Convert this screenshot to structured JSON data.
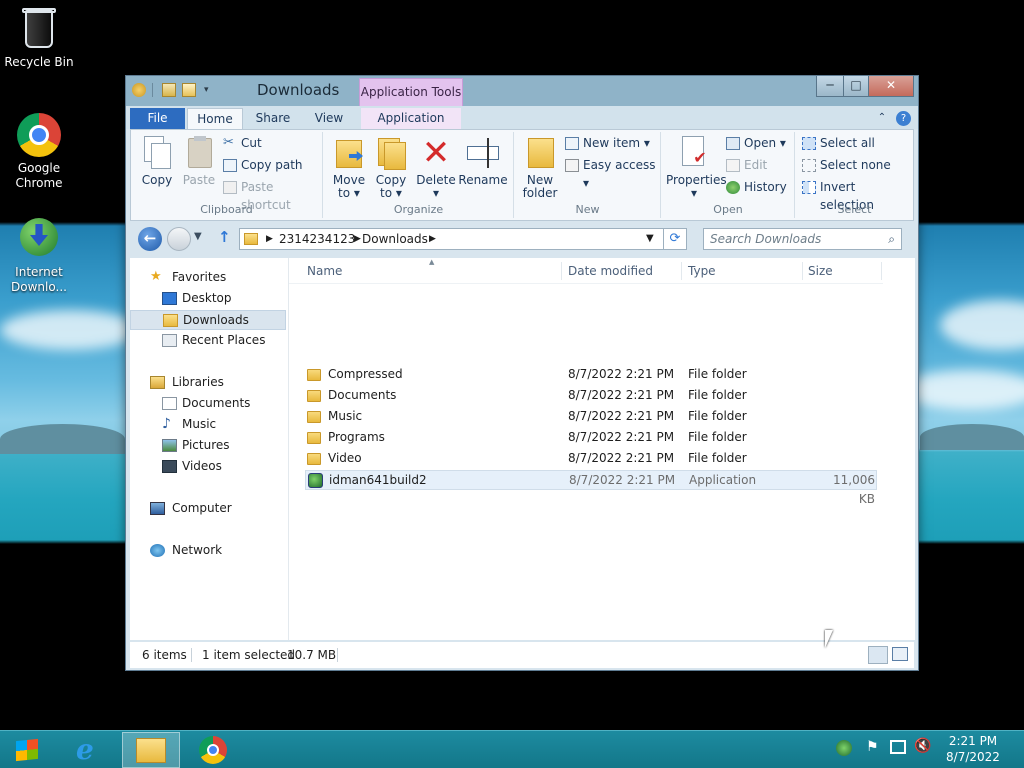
{
  "desktop": {
    "icons": [
      {
        "label_line1": "Recycle Bin",
        "label_line2": ""
      },
      {
        "label_line1": "Google",
        "label_line2": "Chrome"
      },
      {
        "label_line1": "Internet",
        "label_line2": "Downlo..."
      }
    ]
  },
  "window": {
    "title": "Downloads",
    "context_tab": "Application Tools",
    "buttons": {
      "minimize": "─",
      "maximize": "□",
      "close": "✕"
    },
    "tabs": [
      "File",
      "Home",
      "Share",
      "View",
      "Application"
    ],
    "ribbon": {
      "clipboard": {
        "label": "Clipboard",
        "copy": "Copy",
        "paste": "Paste",
        "cut": "Cut",
        "copy_path": "Copy path",
        "paste_shortcut": "Paste shortcut"
      },
      "organize": {
        "label": "Organize",
        "move_to": "Move",
        "move_to2": "to ▾",
        "copy_to": "Copy",
        "copy_to2": "to ▾",
        "delete": "Delete",
        "delete2": "▾",
        "rename": "Rename"
      },
      "new": {
        "label": "New",
        "new_folder": "New",
        "new_folder2": "folder",
        "new_item": "New item ▾",
        "easy_access": "Easy access ▾"
      },
      "open": {
        "label": "Open",
        "properties": "Properties",
        "properties2": "▾",
        "open": "Open ▾",
        "edit": "Edit",
        "history": "History"
      },
      "select": {
        "label": "Select",
        "select_all": "Select all",
        "select_none": "Select none",
        "invert": "Invert selection"
      }
    },
    "address": {
      "segments": [
        "2314234123",
        "Downloads"
      ],
      "search_placeholder": "Search Downloads"
    },
    "nav": {
      "favorites": "Favorites",
      "desktop": "Desktop",
      "downloads": "Downloads",
      "recent": "Recent Places",
      "libraries": "Libraries",
      "documents": "Documents",
      "music": "Music",
      "pictures": "Pictures",
      "videos": "Videos",
      "computer": "Computer",
      "network": "Network"
    },
    "columns": {
      "name": "Name",
      "date": "Date modified",
      "type": "Type",
      "size": "Size"
    },
    "files": [
      {
        "name": "Compressed",
        "date": "8/7/2022 2:21 PM",
        "type": "File folder",
        "size": ""
      },
      {
        "name": "Documents",
        "date": "8/7/2022 2:21 PM",
        "type": "File folder",
        "size": ""
      },
      {
        "name": "Music",
        "date": "8/7/2022 2:21 PM",
        "type": "File folder",
        "size": ""
      },
      {
        "name": "Programs",
        "date": "8/7/2022 2:21 PM",
        "type": "File folder",
        "size": ""
      },
      {
        "name": "Video",
        "date": "8/7/2022 2:21 PM",
        "type": "File folder",
        "size": ""
      },
      {
        "name": "idman641build2",
        "date": "8/7/2022 2:21 PM",
        "type": "Application",
        "size": "11,006 KB"
      }
    ],
    "status": {
      "items": "6 items",
      "selected": "1 item selected",
      "size": "10.7 MB"
    }
  },
  "taskbar": {
    "time": "2:21 PM",
    "date": "8/7/2022"
  },
  "colors": {
    "taskbar": "#137789",
    "ribbon_bg": "#f5f8fb",
    "selected_row": "#e6f0fa",
    "nav_selected": "#d9e4ee",
    "context_tab": "#e3c3ee"
  }
}
